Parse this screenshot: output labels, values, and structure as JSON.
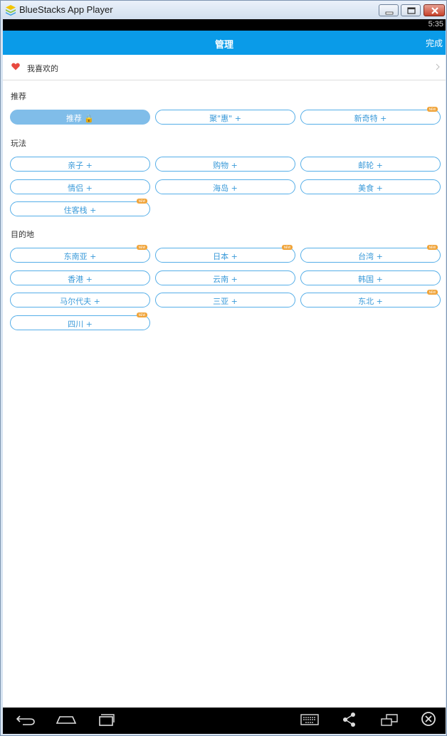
{
  "window": {
    "title": "BlueStacks App Player"
  },
  "status": {
    "time": "5:35"
  },
  "header": {
    "title": "管理",
    "done_label": "完成"
  },
  "favorites": {
    "label": "我喜欢的"
  },
  "sections": [
    {
      "title": "推荐",
      "tags": [
        {
          "label": "推荐 🔒",
          "active": true,
          "new": false
        },
        {
          "label": "聚\"惠\" +",
          "active": false,
          "new": false
        },
        {
          "label": "新奇特 +",
          "active": false,
          "new": true
        }
      ]
    },
    {
      "title": "玩法",
      "tags": [
        {
          "label": "亲子 +",
          "active": false,
          "new": false
        },
        {
          "label": "购物 +",
          "active": false,
          "new": false
        },
        {
          "label": "邮轮 +",
          "active": false,
          "new": false
        },
        {
          "label": "情侣 +",
          "active": false,
          "new": false
        },
        {
          "label": "海岛 +",
          "active": false,
          "new": false
        },
        {
          "label": "美食 +",
          "active": false,
          "new": false
        },
        {
          "label": "住客栈 +",
          "active": false,
          "new": true
        }
      ]
    },
    {
      "title": "目的地",
      "tags": [
        {
          "label": "东南亚 +",
          "active": false,
          "new": true
        },
        {
          "label": "日本 +",
          "active": false,
          "new": true
        },
        {
          "label": "台湾 +",
          "active": false,
          "new": true
        },
        {
          "label": "香港 +",
          "active": false,
          "new": false
        },
        {
          "label": "云南 +",
          "active": false,
          "new": false
        },
        {
          "label": "韩国 +",
          "active": false,
          "new": false
        },
        {
          "label": "马尔代夫 +",
          "active": false,
          "new": false
        },
        {
          "label": "三亚 +",
          "active": false,
          "new": false
        },
        {
          "label": "东北 +",
          "active": false,
          "new": true
        },
        {
          "label": "四川 +",
          "active": false,
          "new": true
        }
      ]
    }
  ],
  "new_badge_text": "NEW",
  "colors": {
    "accent": "#0a9be8",
    "tag_border": "#55aee8",
    "tag_active": "#80bde9",
    "badge": "#f0a43a",
    "heart": "#e8493f"
  },
  "nav_icons": [
    "back-icon",
    "home-icon",
    "recent-apps-icon",
    "keyboard-icon",
    "share-icon",
    "screen-rotate-icon",
    "close-app-icon"
  ]
}
